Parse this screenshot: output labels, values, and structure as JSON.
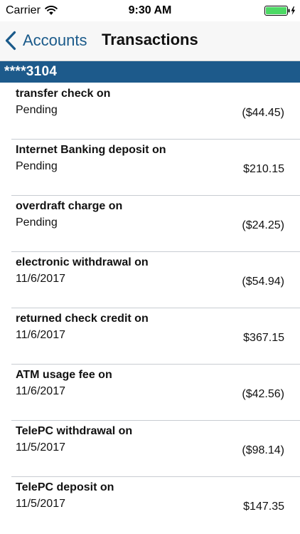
{
  "status_bar": {
    "carrier": "Carrier",
    "time": "9:30 AM",
    "wifi_icon": "wifi-icon",
    "battery_icon": "battery-charging-icon",
    "battery_color": "#4cd964"
  },
  "nav": {
    "back_label": "Accounts",
    "back_icon": "chevron-left-icon",
    "title": "Transactions",
    "accent_color": "#1a5a8a"
  },
  "account": {
    "number": "****3104",
    "header_color": "#1d5a8b"
  },
  "transactions": [
    {
      "description": "transfer check on",
      "date": "Pending",
      "amount": "($44.45)"
    },
    {
      "description": "Internet Banking deposit on",
      "date": "Pending",
      "amount": "$210.15"
    },
    {
      "description": "overdraft charge on",
      "date": "Pending",
      "amount": "($24.25)"
    },
    {
      "description": "electronic withdrawal on",
      "date": "11/6/2017",
      "amount": "($54.94)"
    },
    {
      "description": "returned check credit on",
      "date": "11/6/2017",
      "amount": "$367.15"
    },
    {
      "description": "ATM usage fee on",
      "date": "11/6/2017",
      "amount": "($42.56)"
    },
    {
      "description": "TelePC withdrawal on",
      "date": "11/5/2017",
      "amount": "($98.14)"
    },
    {
      "description": "TelePC deposit on",
      "date": "11/5/2017",
      "amount": "$147.35"
    }
  ]
}
